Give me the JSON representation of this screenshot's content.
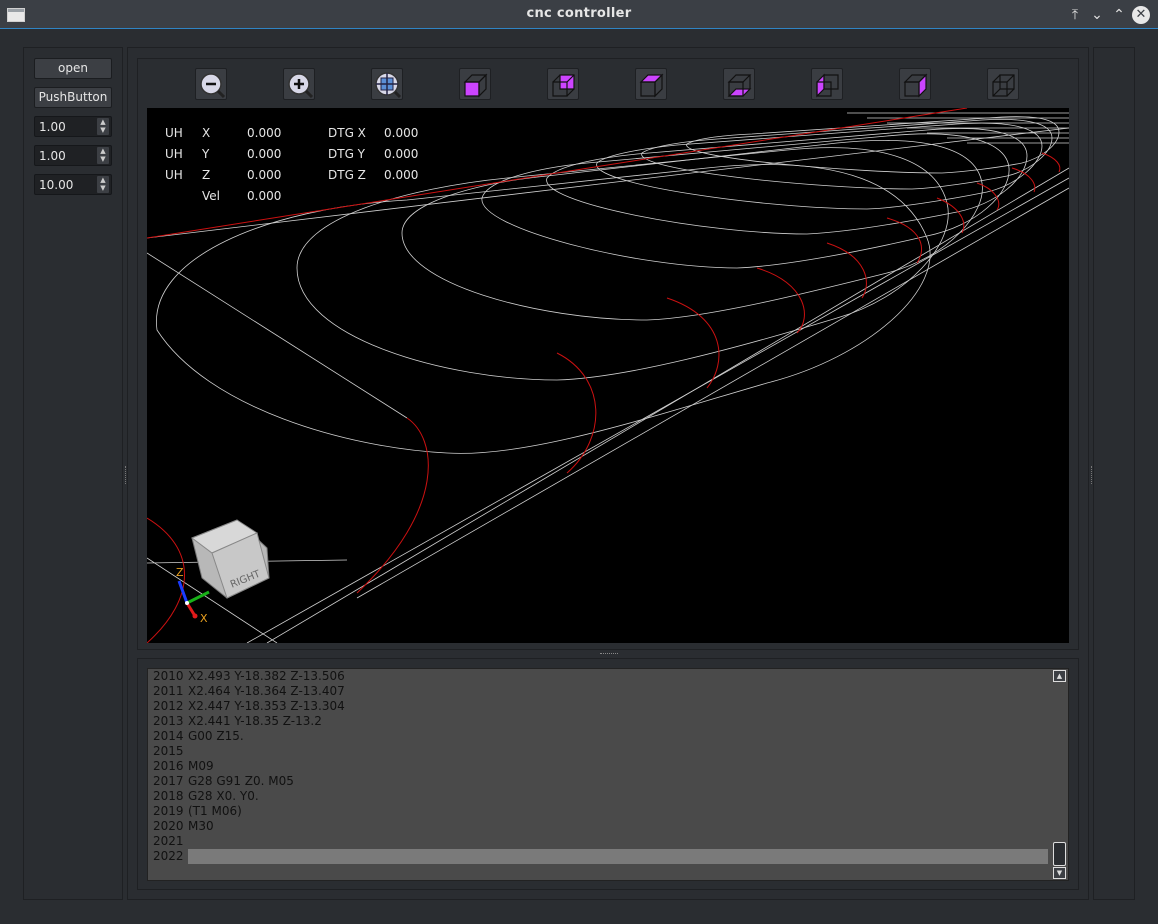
{
  "window": {
    "title": "cnc controller"
  },
  "left_panel": {
    "open_label": "open",
    "push_label": "PushButton",
    "spin1": "1.00",
    "spin2": "1.00",
    "spin3": "10.00"
  },
  "toolbar": {
    "buttons": [
      "zoom-out-icon",
      "zoom-in-icon",
      "zoom-fit-icon",
      "view-iso-icon",
      "view-front-icon",
      "view-top-icon",
      "view-bottom-icon",
      "view-left-icon",
      "view-right-icon",
      "view-wireframe-icon"
    ]
  },
  "dro": {
    "rows": [
      {
        "state": "UH",
        "axis": "X",
        "value": "0.000",
        "dtg_label": "DTG X",
        "dtg_value": "0.000"
      },
      {
        "state": "UH",
        "axis": "Y",
        "value": "0.000",
        "dtg_label": "DTG Y",
        "dtg_value": "0.000"
      },
      {
        "state": "UH",
        "axis": "Z",
        "value": "0.000",
        "dtg_label": "DTG Z",
        "dtg_value": "0.000"
      }
    ],
    "vel_label": "Vel",
    "vel_value": "0.000"
  },
  "view_cube": {
    "face_label": "RIGHT",
    "axis_z": "Z",
    "axis_x": "X"
  },
  "colors": {
    "toolpath": "#d0d0d0",
    "rapid": "#cc1111",
    "cube_face": "#c8c8c8",
    "accent": "#2f84c4",
    "view_face": "#cc44ff"
  },
  "gcode": {
    "lines": [
      {
        "num": "2010",
        "text": "X2.493 Y-18.382 Z-13.506"
      },
      {
        "num": "2011",
        "text": "X2.464 Y-18.364 Z-13.407"
      },
      {
        "num": "2012",
        "text": "X2.447 Y-18.353 Z-13.304"
      },
      {
        "num": "2013",
        "text": "X2.441 Y-18.35 Z-13.2"
      },
      {
        "num": "2014",
        "text": "G00 Z15."
      },
      {
        "num": "2015",
        "text": ""
      },
      {
        "num": "2016",
        "text": "M09"
      },
      {
        "num": "2017",
        "text": "G28 G91 Z0. M05"
      },
      {
        "num": "2018",
        "text": "G28 X0. Y0."
      },
      {
        "num": "2019",
        "text": "(T1 M06)"
      },
      {
        "num": "2020",
        "text": "M30"
      },
      {
        "num": "2021",
        "text": ""
      },
      {
        "num": "2022",
        "text": ""
      }
    ]
  }
}
